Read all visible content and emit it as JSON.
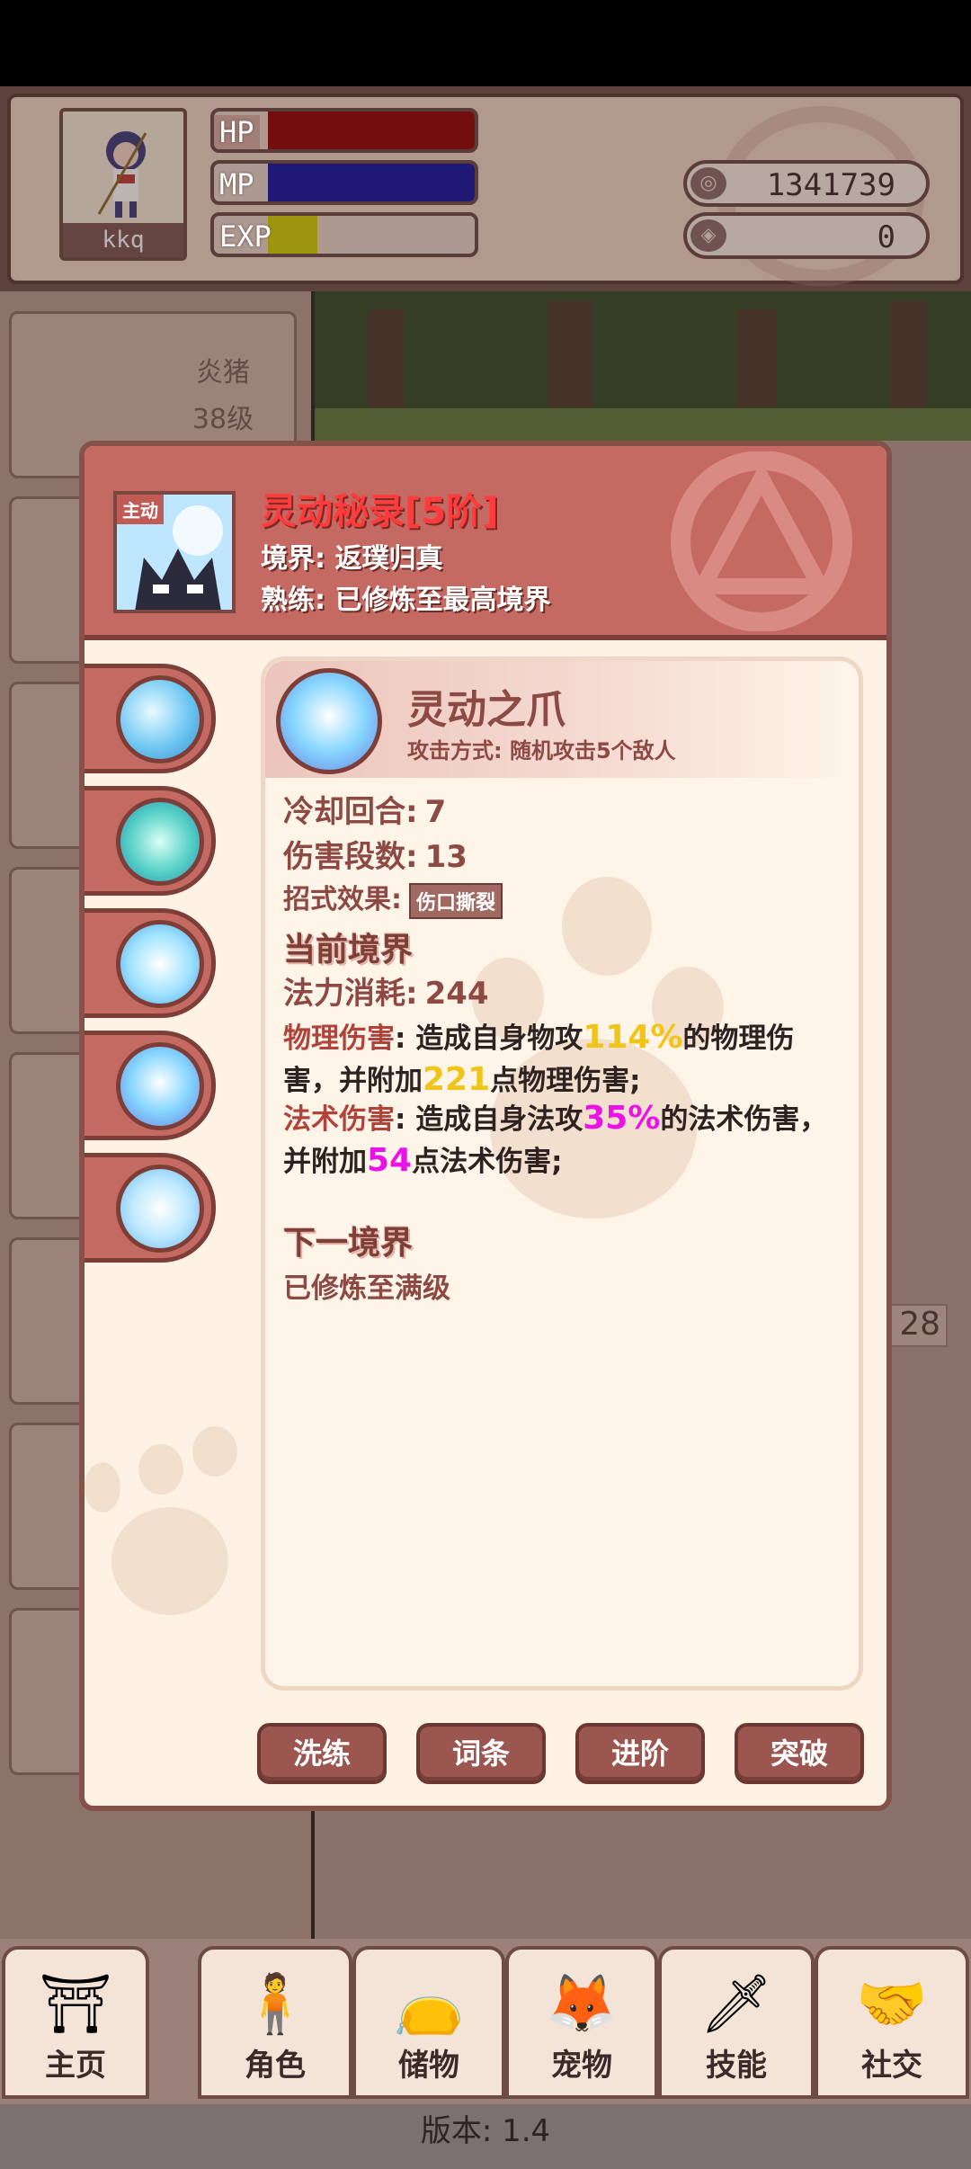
{
  "player": {
    "name": "kkq",
    "hp_label": "HP",
    "mp_label": "MP",
    "exp_label": "EXP",
    "hp_fraction": 1.0,
    "mp_fraction": 1.0,
    "exp_fraction": 0.24,
    "gold": "1341739",
    "gems": "0"
  },
  "background": {
    "enemy_name": "炎猪",
    "enemy_level": "38级",
    "right_value": "28",
    "version_text": "版本: 1.4"
  },
  "modal": {
    "active_tag": "主动",
    "skill_title": "灵动秘录[5阶]",
    "realm": "境界: 返璞归真",
    "mastery": "熟练: 已修炼至最高境界",
    "move_name": "灵动之爪",
    "attack_mode": "攻击方式: 随机攻击5个敌人",
    "cooldown_label": "冷却回合:",
    "cooldown_value": "7",
    "hits_label": "伤害段数:",
    "hits_value": "13",
    "effect_label": "招式效果:",
    "effect_tag": "伤口撕裂",
    "current_realm_title": "当前境界",
    "mana_label": "法力消耗:",
    "mana_value": "244",
    "phys_label": "物理伤害",
    "phys_text_1": ": 造成自身物攻",
    "phys_percent": "114%",
    "phys_text_2": "的物理伤害，并附加",
    "phys_flat": "221",
    "phys_text_3": "点物理伤害;",
    "mag_label": "法术伤害",
    "mag_text_1": ": 造成自身法攻",
    "mag_percent": "35%",
    "mag_text_2": "的法术伤害，并附加",
    "mag_flat": "54",
    "mag_text_3": "点法术伤害;",
    "next_realm_title": "下一境界",
    "next_realm_text": "已修炼至满级",
    "buttons": [
      "洗练",
      "词条",
      "进阶",
      "突破"
    ]
  },
  "nav": {
    "items": [
      {
        "label": "主页",
        "icon": "gate-icon"
      },
      {
        "label": "角色",
        "icon": "character-icon"
      },
      {
        "label": "储物",
        "icon": "bag-icon"
      },
      {
        "label": "宠物",
        "icon": "fox-icon"
      },
      {
        "label": "技能",
        "icon": "sword-icon"
      },
      {
        "label": "社交",
        "icon": "handshake-icon"
      }
    ]
  },
  "colors": {
    "hp": "#8f0000",
    "mp": "#1010a0",
    "exp": "#cfcf00",
    "accent": "#c56a63"
  }
}
